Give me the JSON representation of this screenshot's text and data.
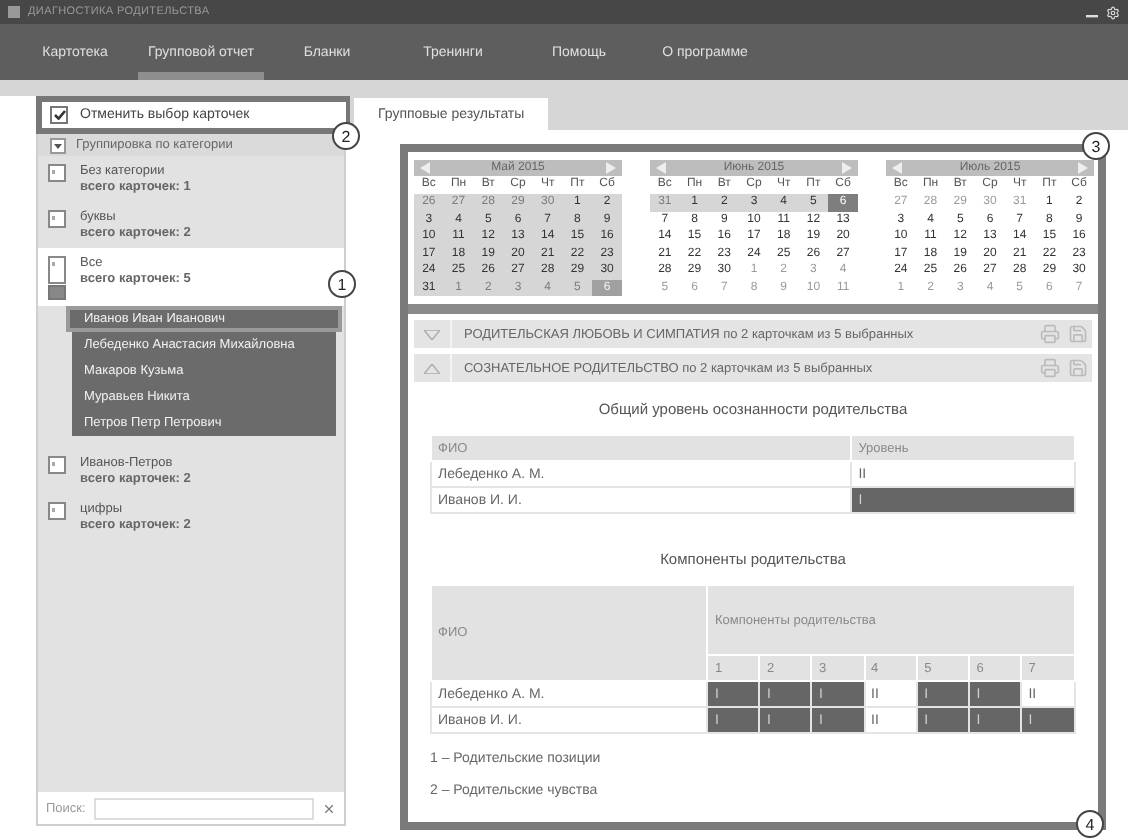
{
  "window": {
    "title": "ДИАГНОСТИКА РОДИТЕЛЬСТВА"
  },
  "menu": [
    {
      "label": "Картотека",
      "selected": false
    },
    {
      "label": "Групповой отчет",
      "selected": true
    },
    {
      "label": "Бланки",
      "selected": false
    },
    {
      "label": "Тренинги",
      "selected": false
    },
    {
      "label": "Помощь",
      "selected": false
    },
    {
      "label": "О программе",
      "selected": false
    }
  ],
  "sidebar": {
    "deselect": {
      "label": "Отменить выбор карточек",
      "checked": true
    },
    "grouping": {
      "label": "Группировка по категории",
      "expanded": true
    },
    "categories": [
      {
        "name": "Без категории",
        "count": "всего карточек: 1",
        "selected": false,
        "expanded": false
      },
      {
        "name": "буквы",
        "count": "всего карточек: 2",
        "selected": false,
        "expanded": false
      },
      {
        "name": "Все",
        "count": "всего карточек: 5",
        "selected": true,
        "expanded": true,
        "children": [
          {
            "name": "Иванов Иван Иванович",
            "selected": true
          },
          {
            "name": "Лебеденко Анастасия  Михайловна",
            "selected": false
          },
          {
            "name": "Макаров Кузьма",
            "selected": false
          },
          {
            "name": "Муравьев Никита",
            "selected": false
          },
          {
            "name": "Петров Петр Петрович",
            "selected": false
          }
        ]
      },
      {
        "name": "Иванов-Петров",
        "count": "всего карточек: 2",
        "selected": false,
        "expanded": false
      },
      {
        "name": "цифры",
        "count": "всего карточек: 2",
        "selected": false,
        "expanded": false
      }
    ],
    "search": {
      "label": "Поиск:"
    }
  },
  "tabs": [
    {
      "label": "Групповые результаты",
      "selected": true
    }
  ],
  "calendars": [
    {
      "month": "Май 2015",
      "weekdays": [
        "Вс",
        "Пн",
        "Вт",
        "Ср",
        "Чт",
        "Пт",
        "Сб"
      ],
      "weeks": [
        [
          {
            "day": "26",
            "muted": true,
            "range": true,
            "selected": false
          },
          {
            "day": "27",
            "muted": true,
            "range": true,
            "selected": false
          },
          {
            "day": "28",
            "muted": true,
            "range": true,
            "selected": false
          },
          {
            "day": "29",
            "muted": true,
            "range": true,
            "selected": false
          },
          {
            "day": "30",
            "muted": true,
            "range": true,
            "selected": false
          },
          {
            "day": "1",
            "muted": false,
            "range": true,
            "selected": false
          },
          {
            "day": "2",
            "muted": false,
            "range": true,
            "selected": false
          }
        ],
        [
          {
            "day": "3",
            "muted": false,
            "range": true,
            "selected": false
          },
          {
            "day": "4",
            "muted": false,
            "range": true,
            "selected": false
          },
          {
            "day": "5",
            "muted": false,
            "range": true,
            "selected": false
          },
          {
            "day": "6",
            "muted": false,
            "range": true,
            "selected": false
          },
          {
            "day": "7",
            "muted": false,
            "range": true,
            "selected": false
          },
          {
            "day": "8",
            "muted": false,
            "range": true,
            "selected": false
          },
          {
            "day": "9",
            "muted": false,
            "range": true,
            "selected": false
          }
        ],
        [
          {
            "day": "10",
            "muted": false,
            "range": true,
            "selected": false
          },
          {
            "day": "11",
            "muted": false,
            "range": true,
            "selected": false
          },
          {
            "day": "12",
            "muted": false,
            "range": true,
            "selected": false
          },
          {
            "day": "13",
            "muted": false,
            "range": true,
            "selected": false
          },
          {
            "day": "14",
            "muted": false,
            "range": true,
            "selected": false
          },
          {
            "day": "15",
            "muted": false,
            "range": true,
            "selected": false
          },
          {
            "day": "16",
            "muted": false,
            "range": true,
            "selected": false
          }
        ],
        [
          {
            "day": "17",
            "muted": false,
            "range": true,
            "selected": false
          },
          {
            "day": "18",
            "muted": false,
            "range": true,
            "selected": false
          },
          {
            "day": "19",
            "muted": false,
            "range": true,
            "selected": false
          },
          {
            "day": "20",
            "muted": false,
            "range": true,
            "selected": false
          },
          {
            "day": "21",
            "muted": false,
            "range": true,
            "selected": false
          },
          {
            "day": "22",
            "muted": false,
            "range": true,
            "selected": false
          },
          {
            "day": "23",
            "muted": false,
            "range": true,
            "selected": false
          }
        ],
        [
          {
            "day": "24",
            "muted": false,
            "range": true,
            "selected": false
          },
          {
            "day": "25",
            "muted": false,
            "range": true,
            "selected": false
          },
          {
            "day": "26",
            "muted": false,
            "range": true,
            "selected": false
          },
          {
            "day": "27",
            "muted": false,
            "range": true,
            "selected": false
          },
          {
            "day": "28",
            "muted": false,
            "range": true,
            "selected": false
          },
          {
            "day": "29",
            "muted": false,
            "range": true,
            "selected": false
          },
          {
            "day": "30",
            "muted": false,
            "range": true,
            "selected": false
          }
        ],
        [
          {
            "day": "31",
            "muted": false,
            "range": true,
            "selected": false
          },
          {
            "day": "1",
            "muted": true,
            "range": true,
            "selected": false
          },
          {
            "day": "2",
            "muted": true,
            "range": true,
            "selected": false
          },
          {
            "day": "3",
            "muted": true,
            "range": true,
            "selected": false
          },
          {
            "day": "4",
            "muted": true,
            "range": true,
            "selected": false
          },
          {
            "day": "5",
            "muted": true,
            "range": true,
            "selected": false
          },
          {
            "day": "6",
            "muted": true,
            "range": true,
            "selected": true
          }
        ]
      ]
    },
    {
      "month": "Июнь 2015",
      "weekdays": [
        "Вс",
        "Пн",
        "Вт",
        "Ср",
        "Чт",
        "Пт",
        "Сб"
      ],
      "weeks": [
        [
          {
            "day": "31",
            "muted": true,
            "range": true,
            "selected": false
          },
          {
            "day": "1",
            "muted": false,
            "range": true,
            "selected": false
          },
          {
            "day": "2",
            "muted": false,
            "range": true,
            "selected": false
          },
          {
            "day": "3",
            "muted": false,
            "range": true,
            "selected": false
          },
          {
            "day": "4",
            "muted": false,
            "range": true,
            "selected": false
          },
          {
            "day": "5",
            "muted": false,
            "range": true,
            "selected": false
          },
          {
            "day": "6",
            "muted": false,
            "range": true,
            "selected": true
          }
        ],
        [
          {
            "day": "7",
            "muted": false,
            "range": false,
            "selected": false
          },
          {
            "day": "8",
            "muted": false,
            "range": false,
            "selected": false
          },
          {
            "day": "9",
            "muted": false,
            "range": false,
            "selected": false
          },
          {
            "day": "10",
            "muted": false,
            "range": false,
            "selected": false
          },
          {
            "day": "11",
            "muted": false,
            "range": false,
            "selected": false
          },
          {
            "day": "12",
            "muted": false,
            "range": false,
            "selected": false
          },
          {
            "day": "13",
            "muted": false,
            "range": false,
            "selected": false
          }
        ],
        [
          {
            "day": "14",
            "muted": false,
            "range": false,
            "selected": false
          },
          {
            "day": "15",
            "muted": false,
            "range": false,
            "selected": false
          },
          {
            "day": "16",
            "muted": false,
            "range": false,
            "selected": false
          },
          {
            "day": "17",
            "muted": false,
            "range": false,
            "selected": false
          },
          {
            "day": "18",
            "muted": false,
            "range": false,
            "selected": false
          },
          {
            "day": "19",
            "muted": false,
            "range": false,
            "selected": false
          },
          {
            "day": "20",
            "muted": false,
            "range": false,
            "selected": false
          }
        ],
        [
          {
            "day": "21",
            "muted": false,
            "range": false,
            "selected": false
          },
          {
            "day": "22",
            "muted": false,
            "range": false,
            "selected": false
          },
          {
            "day": "23",
            "muted": false,
            "range": false,
            "selected": false
          },
          {
            "day": "24",
            "muted": false,
            "range": false,
            "selected": false
          },
          {
            "day": "25",
            "muted": false,
            "range": false,
            "selected": false
          },
          {
            "day": "26",
            "muted": false,
            "range": false,
            "selected": false
          },
          {
            "day": "27",
            "muted": false,
            "range": false,
            "selected": false
          }
        ],
        [
          {
            "day": "28",
            "muted": false,
            "range": false,
            "selected": false
          },
          {
            "day": "29",
            "muted": false,
            "range": false,
            "selected": false
          },
          {
            "day": "30",
            "muted": false,
            "range": false,
            "selected": false
          },
          {
            "day": "1",
            "muted": true,
            "range": false,
            "selected": false
          },
          {
            "day": "2",
            "muted": true,
            "range": false,
            "selected": false
          },
          {
            "day": "3",
            "muted": true,
            "range": false,
            "selected": false
          },
          {
            "day": "4",
            "muted": true,
            "range": false,
            "selected": false
          }
        ],
        [
          {
            "day": "5",
            "muted": true,
            "range": false,
            "selected": false
          },
          {
            "day": "6",
            "muted": true,
            "range": false,
            "selected": false
          },
          {
            "day": "7",
            "muted": true,
            "range": false,
            "selected": false
          },
          {
            "day": "8",
            "muted": true,
            "range": false,
            "selected": false
          },
          {
            "day": "9",
            "muted": true,
            "range": false,
            "selected": false
          },
          {
            "day": "10",
            "muted": true,
            "range": false,
            "selected": false
          },
          {
            "day": "11",
            "muted": true,
            "range": false,
            "selected": false
          }
        ]
      ]
    },
    {
      "month": "Июль 2015",
      "weekdays": [
        "Вс",
        "Пн",
        "Вт",
        "Ср",
        "Чт",
        "Пт",
        "Сб"
      ],
      "weeks": [
        [
          {
            "day": "27",
            "muted": true,
            "range": false,
            "selected": false
          },
          {
            "day": "28",
            "muted": true,
            "range": false,
            "selected": false
          },
          {
            "day": "29",
            "muted": true,
            "range": false,
            "selected": false
          },
          {
            "day": "30",
            "muted": true,
            "range": false,
            "selected": false
          },
          {
            "day": "31",
            "muted": true,
            "range": false,
            "selected": false
          },
          {
            "day": "1",
            "muted": false,
            "range": false,
            "selected": false
          },
          {
            "day": "2",
            "muted": false,
            "range": false,
            "selected": false
          }
        ],
        [
          {
            "day": "3",
            "muted": false,
            "range": false,
            "selected": false
          },
          {
            "day": "4",
            "muted": false,
            "range": false,
            "selected": false
          },
          {
            "day": "5",
            "muted": false,
            "range": false,
            "selected": false
          },
          {
            "day": "6",
            "muted": false,
            "range": false,
            "selected": false
          },
          {
            "day": "7",
            "muted": false,
            "range": false,
            "selected": false
          },
          {
            "day": "8",
            "muted": false,
            "range": false,
            "selected": false
          },
          {
            "day": "9",
            "muted": false,
            "range": false,
            "selected": false
          }
        ],
        [
          {
            "day": "10",
            "muted": false,
            "range": false,
            "selected": false
          },
          {
            "day": "11",
            "muted": false,
            "range": false,
            "selected": false
          },
          {
            "day": "12",
            "muted": false,
            "range": false,
            "selected": false
          },
          {
            "day": "13",
            "muted": false,
            "range": false,
            "selected": false
          },
          {
            "day": "14",
            "muted": false,
            "range": false,
            "selected": false
          },
          {
            "day": "15",
            "muted": false,
            "range": false,
            "selected": false
          },
          {
            "day": "16",
            "muted": false,
            "range": false,
            "selected": false
          }
        ],
        [
          {
            "day": "17",
            "muted": false,
            "range": false,
            "selected": false
          },
          {
            "day": "18",
            "muted": false,
            "range": false,
            "selected": false
          },
          {
            "day": "19",
            "muted": false,
            "range": false,
            "selected": false
          },
          {
            "day": "20",
            "muted": false,
            "range": false,
            "selected": false
          },
          {
            "day": "21",
            "muted": false,
            "range": false,
            "selected": false
          },
          {
            "day": "22",
            "muted": false,
            "range": false,
            "selected": false
          },
          {
            "day": "23",
            "muted": false,
            "range": false,
            "selected": false
          }
        ],
        [
          {
            "day": "24",
            "muted": false,
            "range": false,
            "selected": false
          },
          {
            "day": "25",
            "muted": false,
            "range": false,
            "selected": false
          },
          {
            "day": "26",
            "muted": false,
            "range": false,
            "selected": false
          },
          {
            "day": "27",
            "muted": false,
            "range": false,
            "selected": false
          },
          {
            "day": "28",
            "muted": false,
            "range": false,
            "selected": false
          },
          {
            "day": "29",
            "muted": false,
            "range": false,
            "selected": false
          },
          {
            "day": "30",
            "muted": false,
            "range": false,
            "selected": false
          }
        ],
        [
          {
            "day": "1",
            "muted": true,
            "range": false,
            "selected": false
          },
          {
            "day": "2",
            "muted": true,
            "range": false,
            "selected": false
          },
          {
            "day": "3",
            "muted": true,
            "range": false,
            "selected": false
          },
          {
            "day": "4",
            "muted": true,
            "range": false,
            "selected": false
          },
          {
            "day": "5",
            "muted": true,
            "range": false,
            "selected": false
          },
          {
            "day": "6",
            "muted": true,
            "range": false,
            "selected": false
          },
          {
            "day": "7",
            "muted": true,
            "range": false,
            "selected": false
          }
        ]
      ]
    }
  ],
  "sections": [
    {
      "title": "РОДИТЕЛЬСКАЯ ЛЮБОВЬ И СИМПАТИЯ по 2 карточкам из 5 выбранных",
      "expanded": false
    },
    {
      "title": "СОЗНАТЕЛЬНОЕ РОДИТЕЛЬСТВО по 2 карточкам из 5 выбранных",
      "expanded": true,
      "content": {
        "level_heading": "Общий уровень осознанности родительства",
        "level_table": {
          "columns": [
            "ФИО",
            "Уровень"
          ],
          "rows": [
            {
              "name": "Лебеденко А. М.",
              "cells": [
                {
                  "text": "II",
                  "shaded": false
                }
              ]
            },
            {
              "name": "Иванов И. И.",
              "cells": [
                {
                  "text": "I",
                  "shaded": true
                }
              ]
            }
          ]
        },
        "components_heading": "Компоненты родительства",
        "components_table": {
          "name_header": "ФИО",
          "group_header": "Компоненты родительства",
          "columns": [
            "1",
            "2",
            "3",
            "4",
            "5",
            "6",
            "7"
          ],
          "rows": [
            {
              "name": "Лебеденко А. М.",
              "cells": [
                {
                  "text": "I",
                  "shaded": true
                },
                {
                  "text": "I",
                  "shaded": true
                },
                {
                  "text": "I",
                  "shaded": true
                },
                {
                  "text": "II",
                  "shaded": false
                },
                {
                  "text": "I",
                  "shaded": true
                },
                {
                  "text": "I",
                  "shaded": true
                },
                {
                  "text": "II",
                  "shaded": false
                }
              ]
            },
            {
              "name": "Иванов И. И.",
              "cells": [
                {
                  "text": "I",
                  "shaded": true
                },
                {
                  "text": "I",
                  "shaded": true
                },
                {
                  "text": "I",
                  "shaded": true
                },
                {
                  "text": "II",
                  "shaded": false
                },
                {
                  "text": "I",
                  "shaded": true
                },
                {
                  "text": "I",
                  "shaded": true
                },
                {
                  "text": "I",
                  "shaded": true
                }
              ]
            }
          ]
        },
        "legend": [
          "1 – Родительские позиции",
          "2 – Родительские чувства"
        ]
      }
    }
  ],
  "callouts": [
    "1",
    "2",
    "3",
    "4"
  ]
}
